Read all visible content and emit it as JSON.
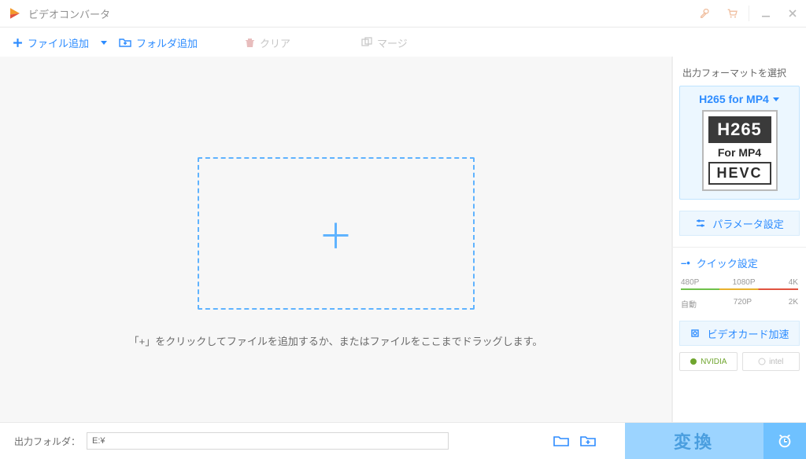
{
  "titlebar": {
    "title": "ビデオコンバータ"
  },
  "toolbar": {
    "add_file": "ファイル追加",
    "add_folder": "フォルダ追加",
    "clear": "クリア",
    "merge": "マージ"
  },
  "stage": {
    "hint": "「+」をクリックしてファイルを追加するか、またはファイルをここまでドラッグします。"
  },
  "side": {
    "title": "出力フォーマットを選択",
    "format_name": "H265 for MP4",
    "badge_main": "H265",
    "badge_for": "For MP4",
    "badge_hevc": "HEVC",
    "params": "パラメータ設定",
    "quick": "クイック設定",
    "row1": {
      "a": "480P",
      "b": "1080P",
      "c": "4K"
    },
    "row2": {
      "a": "自動",
      "b": "720P",
      "c": "2K"
    },
    "gpu": "ビデオカード加速",
    "nvidia": "NVIDIA",
    "intel": "intel"
  },
  "footer": {
    "out_label": "出力フォルダ：",
    "out_path": "E:¥",
    "convert": "変換"
  }
}
